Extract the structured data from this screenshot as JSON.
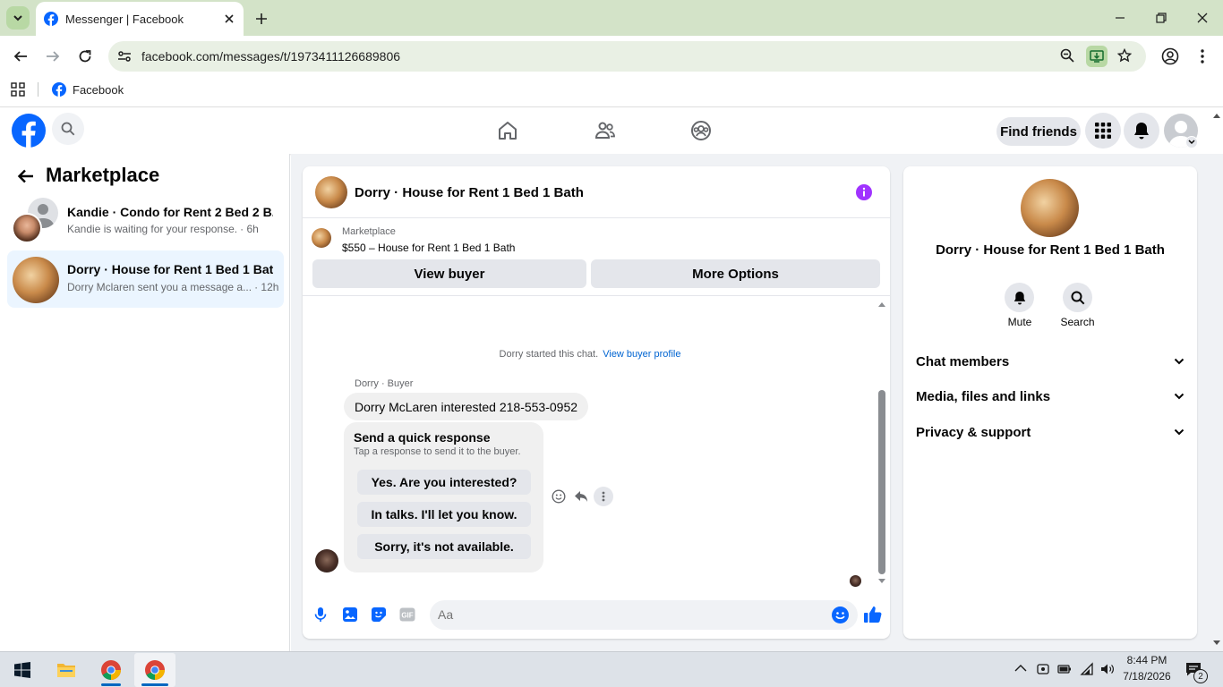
{
  "browser": {
    "tab_title": "Messenger | Facebook",
    "url": "facebook.com/messages/t/1973411126689806",
    "bookmark_label": "Facebook"
  },
  "fb_header": {
    "find_friends_label": "Find friends"
  },
  "sidebar": {
    "title": "Marketplace",
    "conversations": [
      {
        "name": "Kandie · Condo for Rent 2 Bed 2 B...",
        "preview": "Kandie is waiting for your response.",
        "time": "· 6h"
      },
      {
        "name": "Dorry · House for Rent 1 Bed 1 Bath",
        "preview": "Dorry Mclaren sent you a message a...",
        "time": "· 12h"
      }
    ]
  },
  "chat": {
    "title": "Dorry · House for Rent 1 Bed 1 Bath",
    "listing_source": "Marketplace",
    "listing_title": "$550 – House for Rent 1 Bed 1 Bath",
    "view_buyer_label": "View buyer",
    "more_options_label": "More Options",
    "started_text": "Dorry started this chat.",
    "view_profile_link": "View buyer profile",
    "sender_label": "Dorry · Buyer",
    "message_text": "Dorry McLaren interested 218-553-0952",
    "quick_title": "Send a quick response",
    "quick_subtitle": "Tap a response to send it to the buyer.",
    "quick_responses": [
      "Yes. Are you interested?",
      "In talks. I'll let you know.",
      "Sorry, it's not available."
    ],
    "composer_placeholder": "Aa"
  },
  "info": {
    "title": "Dorry · House for Rent 1 Bed 1 Bath",
    "mute_label": "Mute",
    "search_label": "Search",
    "sections": [
      "Chat members",
      "Media, files and links",
      "Privacy & support"
    ]
  },
  "taskbar": {
    "time": "8:44 PM",
    "date": "7/18/2026",
    "notification_count": "2"
  },
  "colors": {
    "fb_blue": "#0866ff",
    "link_blue": "#0064d1",
    "selected_row": "#ebf5ff",
    "info_purple": "#a033ff"
  }
}
